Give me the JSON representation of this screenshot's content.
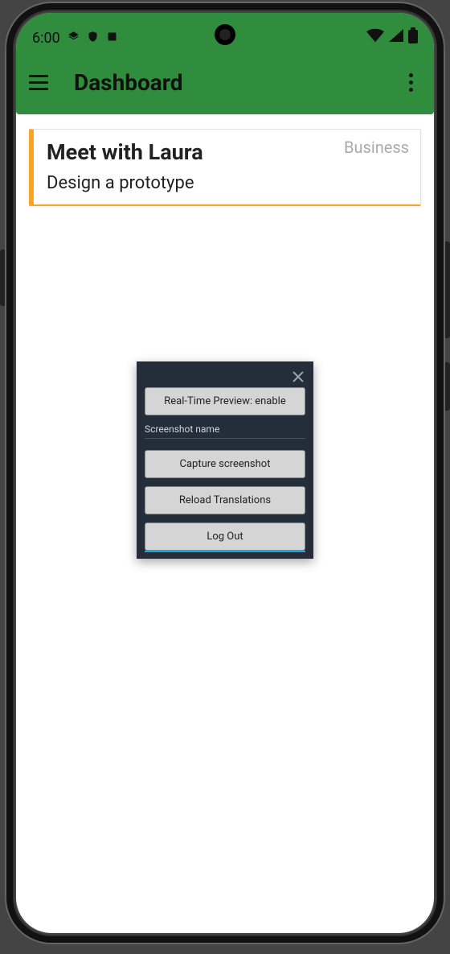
{
  "status": {
    "time": "6:00"
  },
  "appbar": {
    "title": "Dashboard"
  },
  "card": {
    "title": "Meet with Laura",
    "subtitle": "Design a prototype",
    "tag": "Business"
  },
  "panel": {
    "preview_label": "Real-Time Preview: enable",
    "screenshot_label": "Screenshot name",
    "capture_label": "Capture screenshot",
    "reload_label": "Reload Translations",
    "logout_label": "Log Out"
  }
}
